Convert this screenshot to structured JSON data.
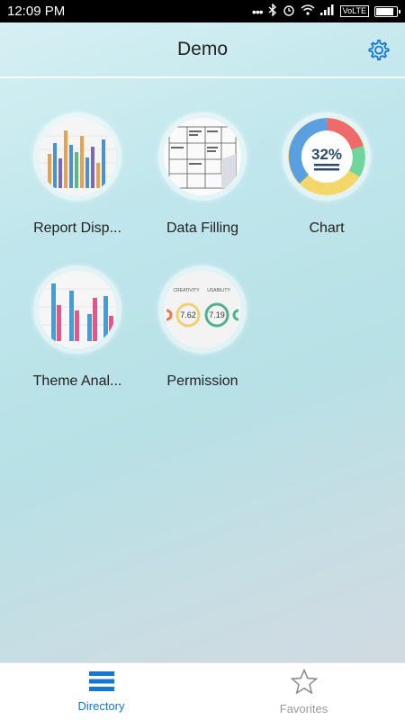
{
  "status": {
    "time": "12:09 PM",
    "network": "VoLTE",
    "battery_level": 0.9
  },
  "header": {
    "title": "Demo",
    "settings_icon": "gear-icon"
  },
  "tiles": [
    {
      "label": "Report Disp...",
      "icon": "bar-chart-thumbnail"
    },
    {
      "label": "Data Filling",
      "icon": "form-thumbnail"
    },
    {
      "label": "Chart",
      "icon": "donut-thumbnail",
      "percent_text": "32%"
    },
    {
      "label": "Theme Anal...",
      "icon": "bar-chart-thumbnail"
    },
    {
      "label": "Permission",
      "icon": "gauge-thumbnail",
      "gauges": [
        {
          "label": "CREATIVITY",
          "value": "7.62"
        },
        {
          "label": "USABILITY",
          "value": "7.19"
        }
      ]
    }
  ],
  "tabbar": {
    "tabs": [
      {
        "label": "Directory",
        "icon": "list-icon",
        "active": true
      },
      {
        "label": "Favorites",
        "icon": "star-icon",
        "active": false
      }
    ]
  },
  "colors": {
    "accent": "#1677d2"
  }
}
